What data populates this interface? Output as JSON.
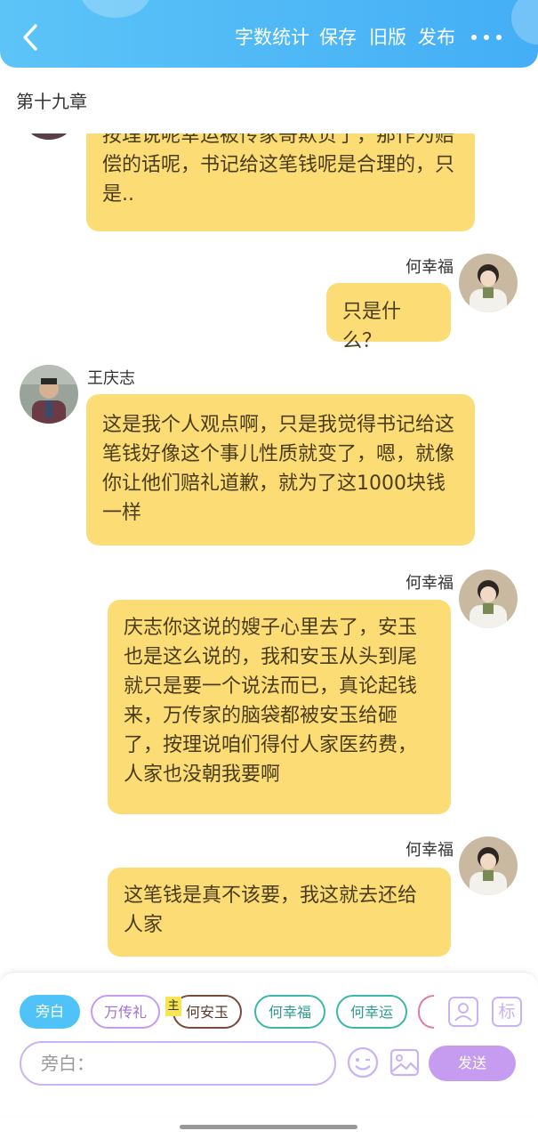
{
  "header": {
    "actions": {
      "word_count": "字数统计",
      "save": "保存",
      "old_version": "旧版",
      "publish": "发布"
    },
    "background_color": "#4db8f6"
  },
  "chapter": {
    "title": "第十九章"
  },
  "messages": [
    {
      "speaker": "王庆志",
      "text": "按理说呢幸运被传家哥欺负了，那作为赔偿的话呢，书记给这笔钱呢是合理的，只是..",
      "name_visible": false
    },
    {
      "speaker": "何幸福",
      "text": "只是什么？"
    },
    {
      "speaker": "王庆志",
      "text": "这是我个人观点啊，只是我觉得书记给这笔钱好像这个事儿性质就变了，嗯，就像你让他们赔礼道歉，就为了这1000块钱一样"
    },
    {
      "speaker": "何幸福",
      "text": "庆志你这说的嫂子心里去了，安玉也是这么说的，我和安玉从头到尾就只是要一个说法而已，真论起钱来，万传家的脑袋都被安玉给砸了，按理说咱们得付人家医药费，人家也没朝我要啊"
    },
    {
      "speaker": "何幸福",
      "text": "这笔钱是真不该要，我这就去还给人家"
    }
  ],
  "roles": [
    {
      "label": "旁白",
      "color": "#4fc3f7",
      "selected": true
    },
    {
      "label": "万传礼",
      "color": "#c69cf0"
    },
    {
      "label": "何安玉",
      "color": "#7a4a3a",
      "badge": "主"
    },
    {
      "label": "何幸福",
      "color": "#3bb8a9"
    },
    {
      "label": "何幸运",
      "color": "#3bb8a9"
    }
  ],
  "toolbar": {
    "tag_button": "标",
    "input_placeholder": "旁白：",
    "send_label": "发送",
    "accent_color": "#c69cf0"
  }
}
